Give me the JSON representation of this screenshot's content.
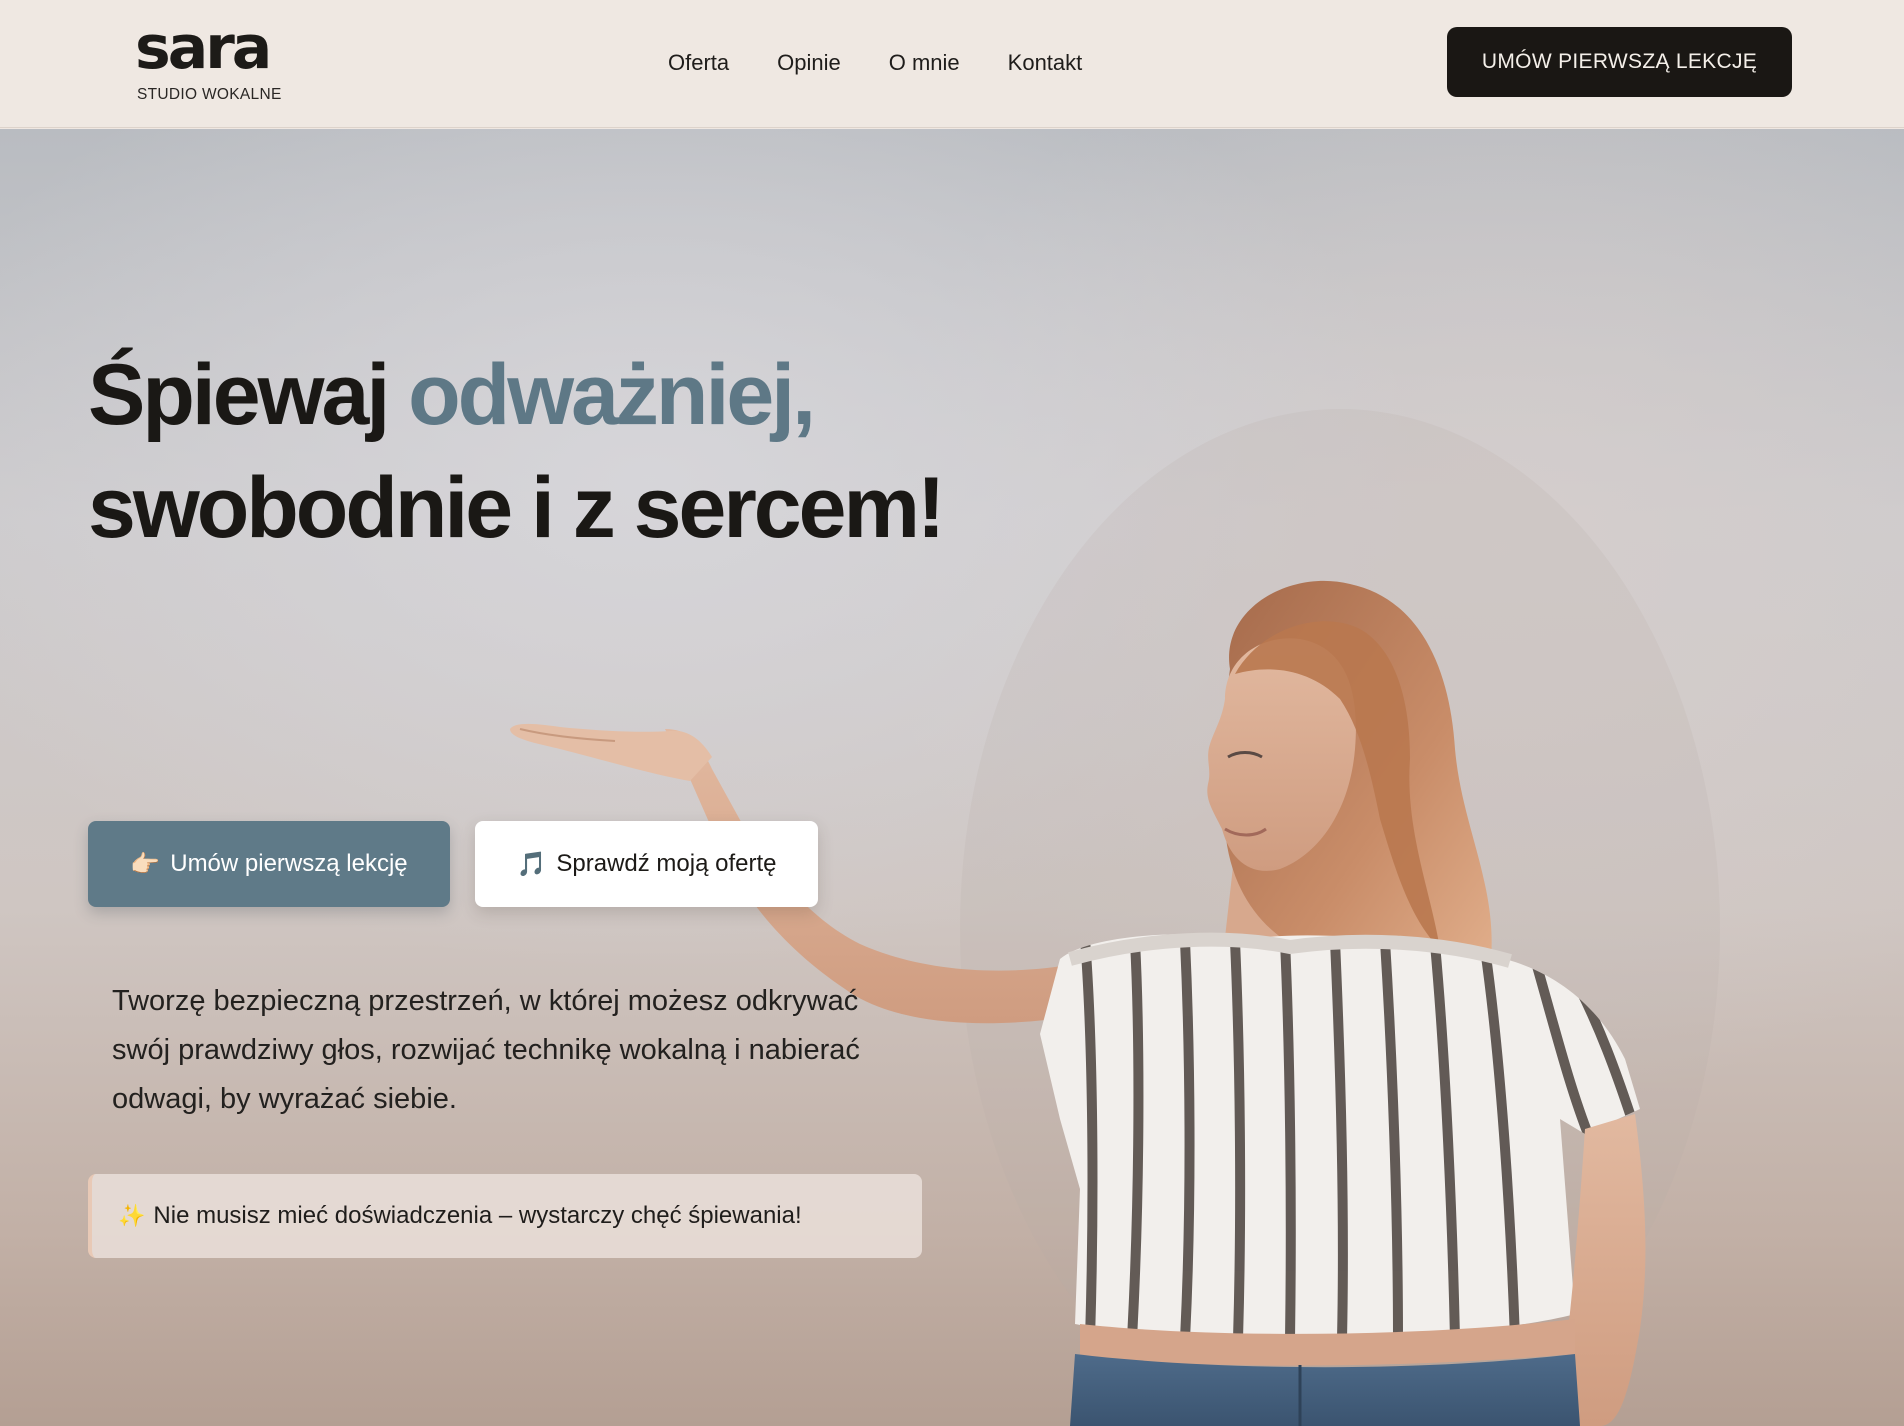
{
  "header": {
    "logo": {
      "name": "sara",
      "subtitle": "STUDIO WOKALNE"
    },
    "nav": [
      "Oferta",
      "Opinie",
      "O mnie",
      "Kontakt"
    ],
    "cta": "UMÓW PIERWSZĄ LEKCJĘ"
  },
  "hero": {
    "headline_part1": "Śpiewaj",
    "headline_accent": "odważniej,",
    "headline_part2": "swobodnie i z sercem!",
    "primary_button": {
      "icon": "👉🏻",
      "label": "Umów pierwszą lekcję"
    },
    "secondary_button": {
      "icon": "🎵",
      "label": "Sprawdź moją ofertę"
    },
    "description": "Tworzę bezpieczną przestrzeń, w której możesz odkrywać swój prawdziwy głos, rozwijać technikę wokalną i nabierać odwagi, by wyrażać siebie.",
    "note": {
      "icon": "✨",
      "text": "Nie musisz mieć doświadczenia – wystarczy chęć śpiewania!"
    }
  },
  "colors": {
    "accent": "#5f7a88",
    "dark": "#1a1714",
    "header_bg": "#efe8e2"
  }
}
